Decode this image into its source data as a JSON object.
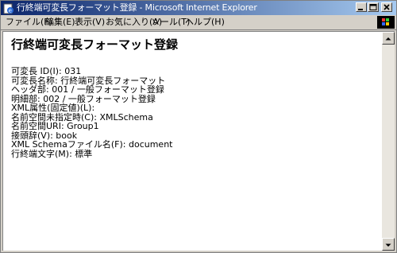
{
  "window": {
    "title": "行終端可変長フォーマット登録 - Microsoft Internet Explorer"
  },
  "menu": [
    {
      "label": "ファイル(F)"
    },
    {
      "label": "編集(E)"
    },
    {
      "label": "表示(V)"
    },
    {
      "label": "お気に入り(A)"
    },
    {
      "label": "ツール(T)"
    },
    {
      "label": "ヘルプ(H)"
    }
  ],
  "page": {
    "title": "行終端可変長フォーマット登録",
    "lines": [
      "可変長 ID(I): 031",
      "可変長名称: 行終端可変長フォーマット",
      "ヘッダ部: 001 / 一般フォーマット登録",
      "明細部: 002 / 一般フォーマット登録",
      "XML属性(固定値)(L):",
      "名前空間未指定時(C): XMLSchema",
      "名前空間URI: Group1",
      "接頭辞(V): book",
      "XML Schemaファイル名(F): document",
      "行終端文字(M): 標準"
    ]
  },
  "colors": {
    "titlebar_start": "#0a246a",
    "titlebar_end": "#a6caf0",
    "chrome": "#d4d0c8"
  }
}
